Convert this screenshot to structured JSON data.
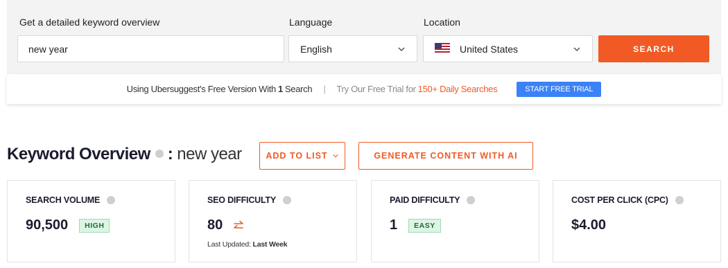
{
  "search": {
    "keyword_label": "Get a detailed keyword overview",
    "keyword_value": "new year",
    "language_label": "Language",
    "language_value": "English",
    "location_label": "Location",
    "location_value": "United States",
    "search_button": "SEARCH"
  },
  "free_bar": {
    "prefix": "Using Ubersuggest's Free Version With",
    "count": "1",
    "suffix": "Search",
    "separator": "|",
    "trial_text": "Try Our Free Trial for",
    "trial_highlight": "150+ Daily Searches",
    "trial_button": "START FREE TRIAL"
  },
  "overview": {
    "title": "Keyword Overview",
    "colon": ":",
    "keyword": "new year",
    "add_to_list": "ADD TO LIST",
    "generate_ai": "GENERATE CONTENT WITH AI"
  },
  "metrics": [
    {
      "label": "SEARCH VOLUME",
      "value": "90,500",
      "badge": "HIGH"
    },
    {
      "label": "SEO DIFFICULTY",
      "value": "80",
      "updated_prefix": "Last Updated:",
      "updated_value": "Last Week"
    },
    {
      "label": "PAID DIFFICULTY",
      "value": "1",
      "badge": "EASY"
    },
    {
      "label": "COST PER CLICK (CPC)",
      "value": "$4.00"
    }
  ],
  "colors": {
    "accent": "#f15a24",
    "trial_button": "#3b82f6",
    "badge_bg": "#ddf5e4"
  }
}
